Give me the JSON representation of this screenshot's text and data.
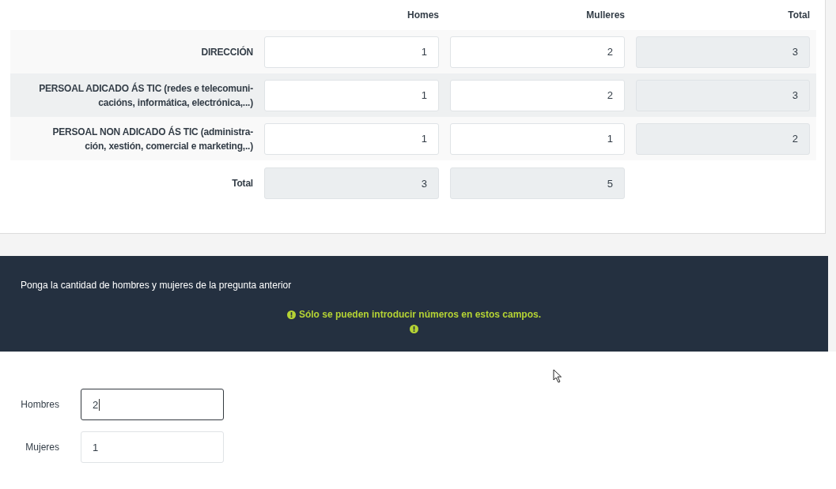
{
  "table": {
    "columns": [
      "Homes",
      "Mulleres",
      "Total"
    ],
    "rows": [
      {
        "label_lines": [
          "DIRECCIÓN"
        ],
        "cells": [
          {
            "value": "1",
            "readonly": false
          },
          {
            "value": "2",
            "readonly": false
          },
          {
            "value": "3",
            "readonly": true
          }
        ]
      },
      {
        "label_lines": [
          "PERSOAL ADICADO ÁS TIC (redes e telecomuni-",
          "cacións, informática, electrónica,...)"
        ],
        "cells": [
          {
            "value": "1",
            "readonly": false
          },
          {
            "value": "2",
            "readonly": false
          },
          {
            "value": "3",
            "readonly": true
          }
        ]
      },
      {
        "label_lines": [
          "PERSOAL NON ADICADO ÁS TIC (administra-",
          "ción, xestión, comercial e marketing,..)"
        ],
        "cells": [
          {
            "value": "1",
            "readonly": false
          },
          {
            "value": "1",
            "readonly": false
          },
          {
            "value": "2",
            "readonly": true
          }
        ]
      }
    ],
    "total_row": {
      "label": "Total",
      "cells": [
        {
          "value": "3",
          "readonly": true
        },
        {
          "value": "5",
          "readonly": true
        }
      ]
    }
  },
  "question": {
    "text": "Ponga la cantidad de hombres y mujeres de la pregunta anterior",
    "warning": "Sólo se pueden introducir números en estos campos."
  },
  "fields": [
    {
      "label": "Hombres",
      "value": "2",
      "focused": true
    },
    {
      "label": "Mujeres",
      "value": "1",
      "focused": false
    }
  ]
}
